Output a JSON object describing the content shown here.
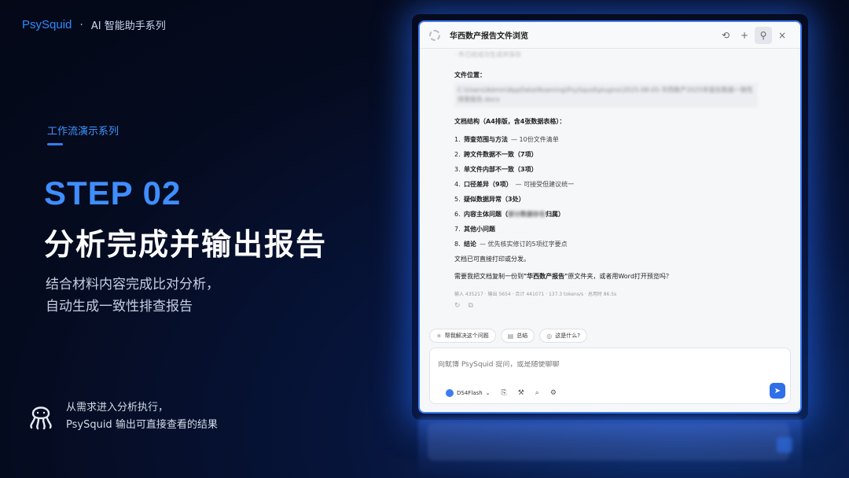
{
  "brand": {
    "name": "PsySquid",
    "separator": "·",
    "series": "AI 智能助手系列"
  },
  "section": {
    "label": "工作流演示系列"
  },
  "slide": {
    "step": "STEP 02",
    "heading": "分析完成并输出报告",
    "desc_line1": "结合材料内容完成比对分析，",
    "desc_line2": "自动生成一致性排查报告"
  },
  "footer": {
    "line1": "从需求进入分析执行，",
    "line2": "PsySquid 输出可直接查看的结果"
  },
  "window": {
    "title": "华西数产报告文件浏览",
    "icons": [
      "history-icon",
      "plus-icon",
      "pin-icon",
      "close-icon"
    ],
    "history_glyph": "⟲",
    "plus_glyph": "+",
    "pin_glyph": "⚲",
    "close_glyph": "×"
  },
  "message": {
    "faded_top": "· 件已经成功生成并保存",
    "file_location_label": "文件位置：",
    "file_path": "C:\\Users\\Admin\\AppData\\Roaming\\PsySquid\\plugins\\2025-08-05-华西数产2025年报告数据一致性排查报告.docx",
    "structure_title": "文档结构（A4排版，含4张数据表格）：",
    "items": [
      {
        "num": "1.",
        "text": "筛查范围与方法",
        "note": "— 10份文件清单"
      },
      {
        "num": "2.",
        "text": "跨文件数据不一致（7项）",
        "note": ""
      },
      {
        "num": "3.",
        "text": "单文件内部不一致（3项）",
        "note": ""
      },
      {
        "num": "4.",
        "text": "口径差异（9项）",
        "note": "— 可接受但建议统一"
      },
      {
        "num": "5.",
        "text": "疑似数据异常（3处）",
        "note": ""
      },
      {
        "num": "6.",
        "text": "内容主体问题（",
        "blurred": "部分数据存在",
        "tail": "归属）"
      },
      {
        "num": "7.",
        "text": "其他小问题",
        "note": ""
      },
      {
        "num": "8.",
        "text": "结论",
        "note": "— 优先核实修订的5项红字要点"
      }
    ],
    "ready": "文档已可直接打印或分发。",
    "ask_prefix": "需要我把文档复制一份到",
    "ask_bold": "\"华西数产报告\"",
    "ask_suffix": "原文件夹，或者用Word打开预览吗？",
    "stats": "输入 435217 · 输出 5654 · 合计 441071 · 137.3 tokens/s · 总用时 86.5s",
    "retry_glyph": "↻",
    "copy_glyph": "⧉"
  },
  "suggestions": [
    {
      "icon": "✳",
      "label": "帮我解决这个问题"
    },
    {
      "icon": "▤",
      "label": "总结"
    },
    {
      "icon": "◎",
      "label": "这是什么?"
    }
  ],
  "composer": {
    "placeholder": "向鱿博 PsySquid 提问，或是随便聊聊",
    "model": "DS4Flash",
    "model_caret": "⌄",
    "attach_glyph": "⎘",
    "tool_glyph": "⚒",
    "search_glyph": "⌕",
    "settings_glyph": "⚙",
    "send_glyph": "➤"
  }
}
